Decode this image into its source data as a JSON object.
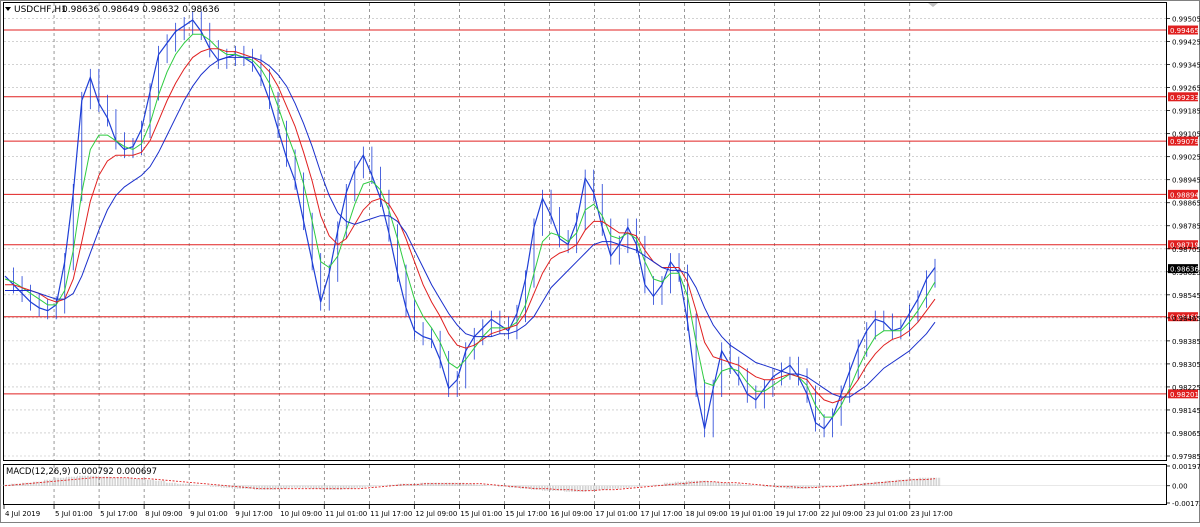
{
  "symbol_label": "USDCHF,H1",
  "ohlc_label": "0.98636 0.98649 0.98632 0.98636",
  "macd_label": "MACD(12,26,9) 0.000792 0.000697",
  "colors": {
    "price": "#1f3fd6",
    "ma_fast": "#2ecc40",
    "ma_mid": "#e02020",
    "ma_slow": "#1a2fcc",
    "level": "#e02020",
    "grid": "#b8b8b8",
    "macd_hist": "#b8b8b8",
    "macd_signal": "#e02020",
    "current_tag": "#000000"
  },
  "chart_data": [
    {
      "type": "line",
      "title": "USDCHF,H1",
      "ylim": [
        0.97985,
        0.99545
      ],
      "y_ticks": [
        "0.99505",
        "0.99425",
        "0.99345",
        "0.99265",
        "0.99185",
        "0.99105",
        "0.99025",
        "0.98945",
        "0.98865",
        "0.98785",
        "0.98705",
        "0.98625",
        "0.98545",
        "0.98465",
        "0.98385",
        "0.98305",
        "0.98225",
        "0.98145",
        "0.98065",
        "0.97985"
      ],
      "x_ticks": [
        "4 Jul 2019",
        "5 Jul 01:00",
        "5 Jul 17:00",
        "8 Jul 09:00",
        "9 Jul 01:00",
        "9 Jul 17:00",
        "10 Jul 09:00",
        "11 Jul 01:00",
        "11 Jul 17:00",
        "12 Jul 09:00",
        "15 Jul 01:00",
        "15 Jul 17:00",
        "16 Jul 09:00",
        "17 Jul 01:00",
        "17 Jul 17:00",
        "18 Jul 09:00",
        "19 Jul 01:00",
        "19 Jul 17:00",
        "22 Jul 09:00",
        "23 Jul 01:00",
        "23 Jul 17:00"
      ],
      "levels": [
        "0.99465",
        "0.99233",
        "0.99079",
        "0.98894",
        "0.98719",
        "0.98469",
        "0.98201"
      ],
      "current_price": "0.98636",
      "series": [
        {
          "values": [
            0.9861,
            0.9858,
            0.9855,
            0.9852,
            0.985,
            0.9849,
            0.9851,
            0.9866,
            0.989,
            0.9922,
            0.993,
            0.9921,
            0.9916,
            0.9908,
            0.9905,
            0.9906,
            0.9912,
            0.9925,
            0.9938,
            0.9942,
            0.9946,
            0.9948,
            0.995,
            0.9946,
            0.994,
            0.9936,
            0.9937,
            0.9938,
            0.9937,
            0.9935,
            0.993,
            0.9922,
            0.9912,
            0.9902,
            0.9894,
            0.988,
            0.9866,
            0.9852,
            0.9862,
            0.9877,
            0.989,
            0.9898,
            0.9903,
            0.9896,
            0.9888,
            0.9876,
            0.9862,
            0.985,
            0.9842,
            0.984,
            0.9839,
            0.9832,
            0.9822,
            0.9825,
            0.9835,
            0.984,
            0.9843,
            0.9846,
            0.9844,
            0.9842,
            0.9848,
            0.986,
            0.9878,
            0.9888,
            0.9882,
            0.9874,
            0.9872,
            0.988,
            0.9895,
            0.989,
            0.9878,
            0.9868,
            0.9872,
            0.9878,
            0.9872,
            0.9858,
            0.9854,
            0.9858,
            0.9866,
            0.9862,
            0.9845,
            0.9822,
            0.9808,
            0.9822,
            0.9835,
            0.983,
            0.9826,
            0.982,
            0.9818,
            0.9822,
            0.9826,
            0.9828,
            0.983,
            0.9826,
            0.982,
            0.981,
            0.9808,
            0.9812,
            0.982,
            0.9828,
            0.9836,
            0.9842,
            0.9846,
            0.9845,
            0.9842,
            0.9843,
            0.9848,
            0.9853,
            0.986,
            0.9864
          ]
        },
        {
          "values": [
            0.986,
            0.9859,
            0.9857,
            0.9855,
            0.9853,
            0.9851,
            0.9851,
            0.9856,
            0.987,
            0.989,
            0.9905,
            0.991,
            0.991,
            0.9908,
            0.9906,
            0.9905,
            0.9907,
            0.9914,
            0.9924,
            0.9932,
            0.9938,
            0.9942,
            0.9945,
            0.9945,
            0.9943,
            0.994,
            0.9938,
            0.9938,
            0.9937,
            0.9936,
            0.9933,
            0.9928,
            0.992,
            0.9911,
            0.9903,
            0.9893,
            0.988,
            0.9866,
            0.9864,
            0.9868,
            0.9877,
            0.9886,
            0.9893,
            0.9894,
            0.9891,
            0.9884,
            0.9874,
            0.9863,
            0.9853,
            0.9847,
            0.9843,
            0.9838,
            0.9831,
            0.9829,
            0.9832,
            0.9836,
            0.984,
            0.9843,
            0.9843,
            0.9843,
            0.9845,
            0.9851,
            0.9862,
            0.9873,
            0.9876,
            0.9875,
            0.9873,
            0.9876,
            0.9884,
            0.9886,
            0.9882,
            0.9875,
            0.9874,
            0.9876,
            0.9874,
            0.9866,
            0.986,
            0.9859,
            0.9862,
            0.9862,
            0.9854,
            0.9838,
            0.9824,
            0.9823,
            0.9828,
            0.9829,
            0.9828,
            0.9824,
            0.9821,
            0.9821,
            0.9823,
            0.9825,
            0.9827,
            0.9826,
            0.9823,
            0.9816,
            0.9812,
            0.9812,
            0.9816,
            0.9822,
            0.9829,
            0.9835,
            0.984,
            0.9842,
            0.9842,
            0.9842,
            0.9845,
            0.9849,
            0.9854,
            0.9859
          ]
        },
        {
          "values": [
            0.9858,
            0.9858,
            0.9857,
            0.9856,
            0.9855,
            0.9853,
            0.9852,
            0.9853,
            0.986,
            0.9873,
            0.9887,
            0.9896,
            0.9901,
            0.9903,
            0.9903,
            0.9903,
            0.9904,
            0.9908,
            0.9915,
            0.9922,
            0.9928,
            0.9933,
            0.9937,
            0.9939,
            0.994,
            0.994,
            0.9939,
            0.9939,
            0.9938,
            0.9937,
            0.9935,
            0.9932,
            0.9927,
            0.992,
            0.9913,
            0.9904,
            0.9894,
            0.9882,
            0.9875,
            0.9872,
            0.9874,
            0.9879,
            0.9884,
            0.9887,
            0.9888,
            0.9886,
            0.9881,
            0.9874,
            0.9866,
            0.9858,
            0.9852,
            0.9847,
            0.9841,
            0.9837,
            0.9836,
            0.9837,
            0.9839,
            0.9841,
            0.9842,
            0.9843,
            0.9844,
            0.9848,
            0.9855,
            0.9862,
            0.9867,
            0.9869,
            0.987,
            0.9872,
            0.9877,
            0.988,
            0.988,
            0.9878,
            0.9876,
            0.9876,
            0.9875,
            0.987,
            0.9866,
            0.9864,
            0.9864,
            0.9864,
            0.9859,
            0.9849,
            0.9838,
            0.9833,
            0.9832,
            0.9831,
            0.983,
            0.9828,
            0.9826,
            0.9825,
            0.9825,
            0.9826,
            0.9827,
            0.9826,
            0.9825,
            0.9821,
            0.9818,
            0.9817,
            0.9818,
            0.9821,
            0.9825,
            0.983,
            0.9834,
            0.9837,
            0.9839,
            0.984,
            0.9842,
            0.9845,
            0.9849,
            0.9853
          ]
        },
        {
          "values": [
            0.9856,
            0.9856,
            0.9856,
            0.9856,
            0.9855,
            0.9854,
            0.9853,
            0.9853,
            0.9855,
            0.9861,
            0.9869,
            0.9877,
            0.9884,
            0.9889,
            0.9892,
            0.9894,
            0.9896,
            0.9899,
            0.9904,
            0.991,
            0.9916,
            0.9922,
            0.9927,
            0.9931,
            0.9934,
            0.9936,
            0.9937,
            0.9937,
            0.9937,
            0.9937,
            0.9936,
            0.9934,
            0.9931,
            0.9927,
            0.9921,
            0.9914,
            0.9906,
            0.9897,
            0.9889,
            0.9883,
            0.988,
            0.9879,
            0.988,
            0.9881,
            0.9882,
            0.9882,
            0.988,
            0.9876,
            0.987,
            0.9864,
            0.9858,
            0.9853,
            0.9848,
            0.9844,
            0.9841,
            0.984,
            0.984,
            0.984,
            0.9841,
            0.9841,
            0.9842,
            0.9844,
            0.9847,
            0.9852,
            0.9857,
            0.986,
            0.9863,
            0.9866,
            0.9869,
            0.9872,
            0.9873,
            0.9873,
            0.9872,
            0.9871,
            0.987,
            0.9868,
            0.9866,
            0.9864,
            0.9863,
            0.9863,
            0.9862,
            0.9857,
            0.985,
            0.9844,
            0.984,
            0.9837,
            0.9835,
            0.9833,
            0.9831,
            0.983,
            0.9829,
            0.9828,
            0.9827,
            0.9827,
            0.9826,
            0.9824,
            0.9822,
            0.982,
            0.9819,
            0.9819,
            0.9821,
            0.9823,
            0.9826,
            0.9829,
            0.9831,
            0.9833,
            0.9835,
            0.9838,
            0.9841,
            0.9845
          ]
        }
      ]
    },
    {
      "type": "bar",
      "title": "MACD(12,26,9)",
      "y_ticks": [
        "0.001975",
        "0.00",
        "-0.001731"
      ],
      "ylim": [
        -0.001731,
        0.001975
      ],
      "series": [
        {
          "values": [
            0.0001,
            0.0002,
            0.0003,
            0.0004,
            0.0006,
            0.0008,
            0.0009,
            0.001,
            0.001,
            0.0009,
            0.0008,
            0.0008,
            0.0007,
            0.0006,
            0.0005,
            0.0003,
            0.0002,
            0.0001,
            0.0,
            -0.0001,
            -0.0002,
            -0.0003,
            -0.0003,
            -0.0004,
            -0.0004,
            -0.0003,
            -0.0002,
            -0.0002,
            -0.0003,
            -0.0004,
            -0.0004,
            -0.0003,
            -0.0002,
            -0.0001,
            0.0,
            0.0001,
            0.0002,
            0.0002,
            0.0003,
            0.0003,
            0.0003,
            0.0003,
            0.0002,
            0.0001,
            0.0,
            -0.0001,
            -0.0002,
            -0.0003,
            -0.0004,
            -0.0005,
            -0.0005,
            -0.0006,
            -0.0006,
            -0.0005,
            -0.0004,
            -0.0003,
            -0.0002,
            -0.0001,
            0.0,
            0.0001,
            0.0003,
            0.0004,
            0.0005,
            0.0005,
            0.0004,
            0.0003,
            0.0002,
            0.0001,
            0.0,
            -0.0001,
            -0.0002,
            -0.0003,
            -0.0003,
            -0.0002,
            -0.0001,
            0.0,
            0.0001,
            0.0002,
            0.0003,
            0.0004,
            0.0005,
            0.0006,
            0.0007,
            0.0008,
            0.0008
          ]
        },
        {
          "values": [
            0.0,
            0.0001,
            0.0002,
            0.0003,
            0.0004,
            0.0005,
            0.0006,
            0.0007,
            0.0008,
            0.0008,
            0.0008,
            0.0008,
            0.0007,
            0.0007,
            0.0006,
            0.0005,
            0.0004,
            0.0003,
            0.0002,
            0.0001,
            0.0,
            -0.0001,
            -0.0002,
            -0.0003,
            -0.0003,
            -0.0003,
            -0.0003,
            -0.0003,
            -0.0003,
            -0.0003,
            -0.0003,
            -0.0003,
            -0.0003,
            -0.0002,
            -0.0001,
            0.0,
            0.0001,
            0.0001,
            0.0002,
            0.0002,
            0.0002,
            0.0002,
            0.0002,
            0.0002,
            0.0001,
            0.0,
            -0.0001,
            -0.0002,
            -0.0003,
            -0.0003,
            -0.0004,
            -0.0004,
            -0.0005,
            -0.0005,
            -0.0004,
            -0.0004,
            -0.0003,
            -0.0002,
            -0.0001,
            0.0,
            0.0001,
            0.0002,
            0.0003,
            0.0004,
            0.0004,
            0.0003,
            0.0003,
            0.0002,
            0.0001,
            0.0,
            -0.0001,
            -0.0001,
            -0.0002,
            -0.0002,
            -0.0001,
            -0.0001,
            0.0,
            0.0001,
            0.0002,
            0.0003,
            0.0004,
            0.0005,
            0.0006,
            0.0006,
            0.0007
          ]
        }
      ]
    }
  ]
}
